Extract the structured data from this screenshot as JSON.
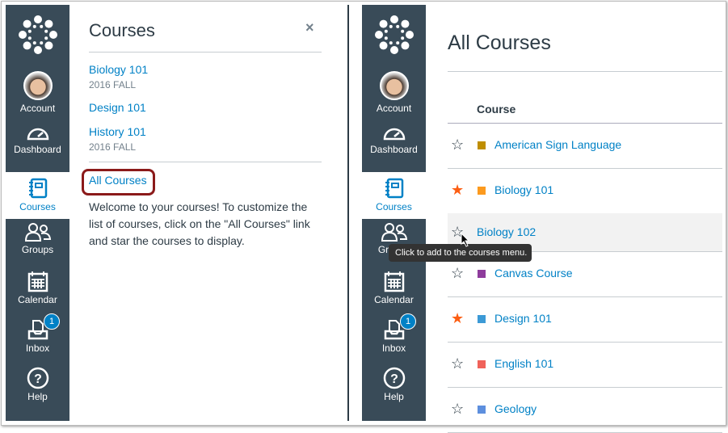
{
  "nav": {
    "items": [
      {
        "label": "Account"
      },
      {
        "label": "Dashboard"
      },
      {
        "label": "Courses"
      },
      {
        "label": "Groups"
      },
      {
        "label": "Calendar"
      },
      {
        "label": "Inbox",
        "badge": "1"
      },
      {
        "label": "Help"
      }
    ],
    "bg": "#394B58",
    "active_color": "#0081c6"
  },
  "tray": {
    "title": "Courses",
    "close": "×",
    "courses": [
      {
        "name": "Biology 101",
        "term": "2016 FALL"
      },
      {
        "name": "Design 101",
        "term": ""
      },
      {
        "name": "History 101",
        "term": "2016 FALL"
      }
    ],
    "all_courses": "All Courses",
    "welcome": "Welcome to your courses! To customize the list of courses, click on the \"All Courses\" link and star the courses to display."
  },
  "main": {
    "title": "All Courses",
    "column": "Course",
    "courses": [
      {
        "name": "American Sign Language",
        "starred": false,
        "color": "#BF8E00"
      },
      {
        "name": "Biology 101",
        "starred": true,
        "color": "#FC9A1E"
      },
      {
        "name": "Biology 102",
        "starred": false,
        "color": ""
      },
      {
        "name": "Canvas Course",
        "starred": false,
        "color": "#8E3C9C"
      },
      {
        "name": "Design 101",
        "starred": true,
        "color": "#3C9AD6"
      },
      {
        "name": "English 101",
        "starred": false,
        "color": "#F0625A"
      },
      {
        "name": "Geology",
        "starred": false,
        "color": "#5D8FDE"
      }
    ],
    "tooltip": "Click to add to the courses menu."
  }
}
